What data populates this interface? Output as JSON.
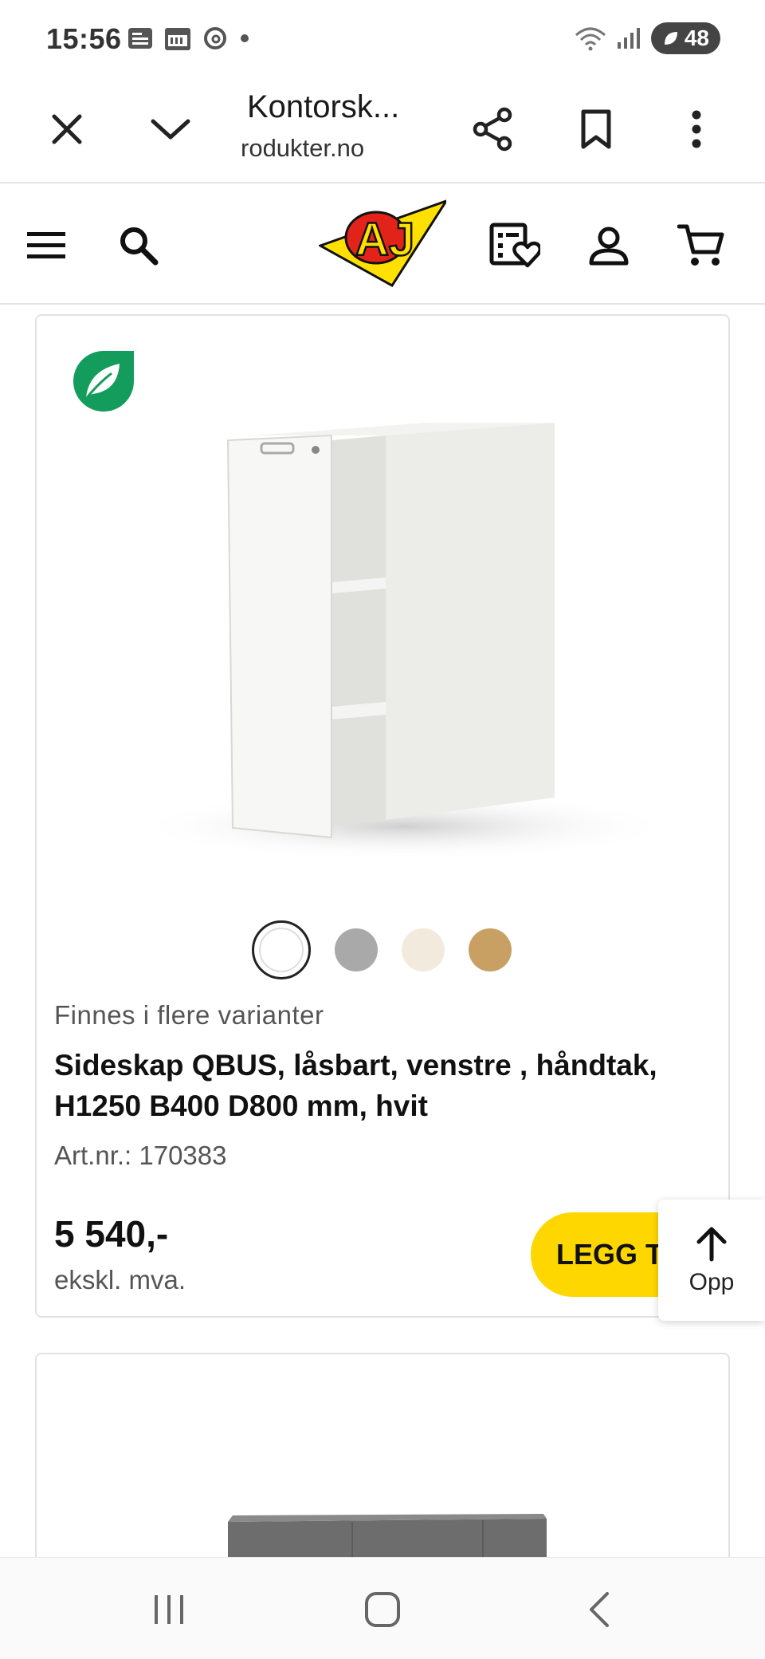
{
  "status_bar": {
    "time": "15:56",
    "battery": "48",
    "network": "5"
  },
  "browser": {
    "title": "Kontorsk...",
    "url": "rodukter.no"
  },
  "site_header": {
    "logo_text": "AJ"
  },
  "product": {
    "variants_text": "Finnes i flere varianter",
    "name": "Sideskap QBUS, låsbart, venstre , håndtak, H1250 B400 D800 mm, hvit",
    "art_nr": "Art.nr.: 170383",
    "price": "5 540,-",
    "price_note": "ekskl. mva.",
    "add_button": "LEGG TIL",
    "swatches": [
      {
        "color": "#ffffff",
        "selected": true
      },
      {
        "color": "#a9a9a9",
        "selected": false
      },
      {
        "color": "#f2ebdd",
        "selected": false
      },
      {
        "color": "#c9a063",
        "selected": false
      }
    ]
  },
  "scroll_up": {
    "label": "Opp"
  },
  "colors": {
    "accent_yellow": "#ffd700",
    "eco_green": "#149c5c",
    "logo_red": "#e2231a"
  }
}
